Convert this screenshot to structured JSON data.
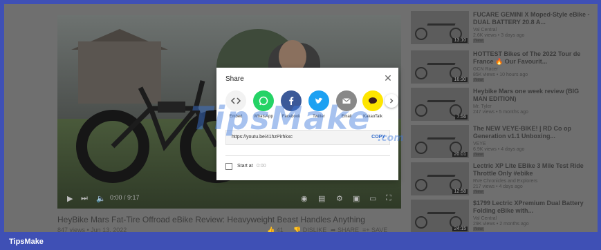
{
  "video": {
    "title": "HeyBike Mars Fat-Tire Offroad eBike Review: Heavyweight Beast Handles Anything",
    "views_date": "847 views • Jun 13, 2022",
    "time": "0:00 / 9:17",
    "likes": "41",
    "dislike_label": "DISLIKE",
    "share_label": "SHARE",
    "save_label": "SAVE"
  },
  "share_dialog": {
    "title": "Share",
    "close_glyph": "✕",
    "options": [
      {
        "label": "Embed",
        "icon": "embed-icon",
        "color": "#f2f2f2"
      },
      {
        "label": "WhatsApp",
        "icon": "whatsapp-icon",
        "color": "#25d366"
      },
      {
        "label": "Facebook",
        "icon": "facebook-icon",
        "color": "#3b5998"
      },
      {
        "label": "Twitter",
        "icon": "twitter-icon",
        "color": "#1da1f2"
      },
      {
        "label": "Email",
        "icon": "email-icon",
        "color": "#888888"
      },
      {
        "label": "KakaoTalk",
        "icon": "kakaotalk-icon",
        "color": "#fee500"
      }
    ],
    "link": "https://youtu.be/41hzPirhkxc",
    "copy_label": "COPY",
    "start_label": "Start at",
    "start_time": "0:00"
  },
  "recommended": [
    {
      "title": "FUCARE GEMINI X Moped-Style eBike - DUAL BATTERY 20.8 A...",
      "channel": "Val Central",
      "stats": "2.6K views • 3 days ago",
      "badge": "New",
      "duration": "13:10"
    },
    {
      "title": "HOTTEST Bikes of The 2022 Tour de France 🔥 Our Favourit...",
      "channel": "GCN Racer",
      "stats": "85K views • 10 hours ago",
      "badge": "New",
      "duration": "16:30"
    },
    {
      "title": "Heybike Mars one week review (BIG MAN EDITION)",
      "channel": "Mr. Tyler",
      "stats": "247 views • 5 months ago",
      "badge": "",
      "duration": "7:56"
    },
    {
      "title": "The NEW VEYE-BIKE! | RD Co op Generation v1.1 Unboxing...",
      "channel": "VEYE",
      "stats": "6.9K views • 4 days ago",
      "badge": "New",
      "duration": "20:01"
    },
    {
      "title": "Lectric XP Lite EBike 3 Mile Test Ride Throttle Only #ebike",
      "channel": "RVe Chronicles and Explorers",
      "stats": "217 views • 4 days ago",
      "badge": "New",
      "duration": "12:58"
    },
    {
      "title": "$1799 Lectric XPremium Dual Battery Folding eBike with...",
      "channel": "Val Central",
      "stats": "29K views • 2 months ago",
      "badge": "New",
      "duration": "24:15"
    }
  ],
  "watermark": {
    "text": "TipsMake",
    "suffix": ".com"
  },
  "footer": {
    "brand": "TipsMake"
  },
  "colors": {
    "frame": "#3f50b5",
    "copy": "#2a66c8"
  }
}
